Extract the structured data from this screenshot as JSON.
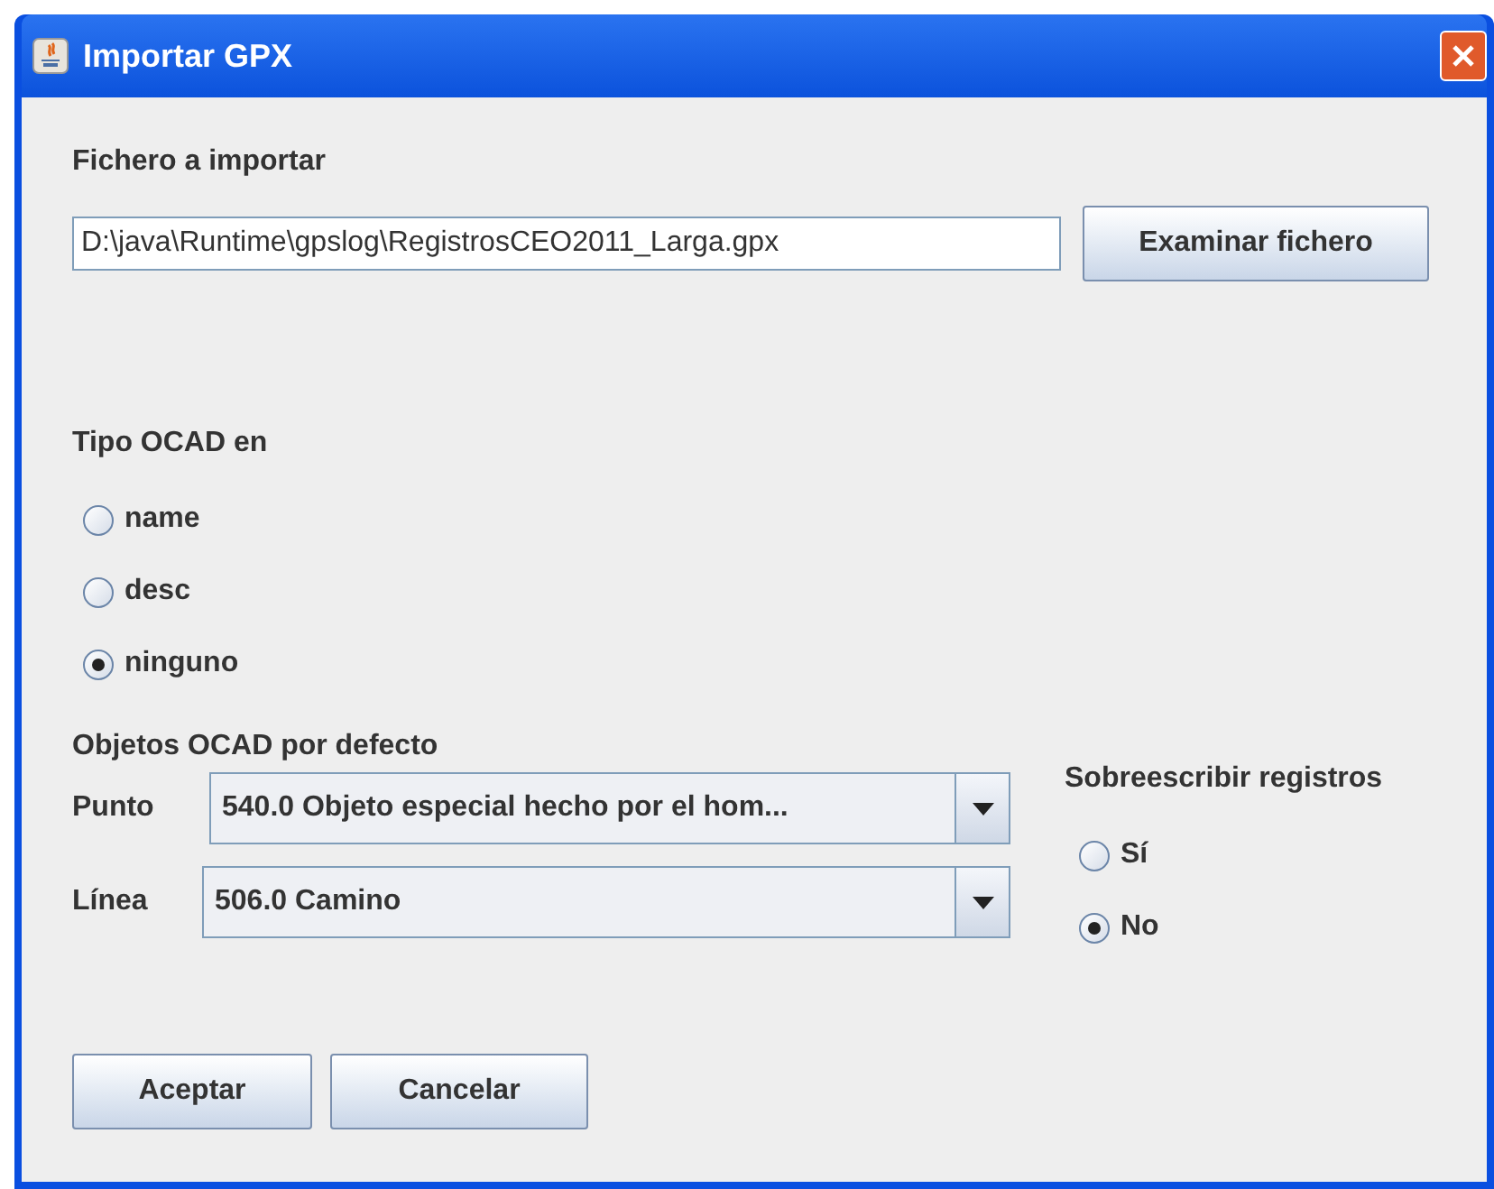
{
  "window": {
    "title": "Importar GPX"
  },
  "file": {
    "label": "Fichero a importar",
    "value": "D:\\java\\Runtime\\gpslog\\RegistrosCEO2011_Larga.gpx",
    "browse_button": "Examinar fichero"
  },
  "ocad_type": {
    "label": "Tipo OCAD en",
    "options": [
      {
        "label": "name",
        "selected": false
      },
      {
        "label": "desc",
        "selected": false
      },
      {
        "label": "ninguno",
        "selected": true
      }
    ]
  },
  "defaults": {
    "label": "Objetos OCAD por defecto",
    "fields": [
      {
        "label": "Punto",
        "value": "540.0 Objeto especial hecho por el hom..."
      },
      {
        "label": "Línea",
        "value": "506.0 Camino"
      }
    ]
  },
  "overwrite": {
    "label": "Sobreescribir registros",
    "options": [
      {
        "label": "Sí",
        "selected": false
      },
      {
        "label": "No",
        "selected": true
      }
    ]
  },
  "buttons": [
    "Aceptar",
    "Cancelar"
  ]
}
